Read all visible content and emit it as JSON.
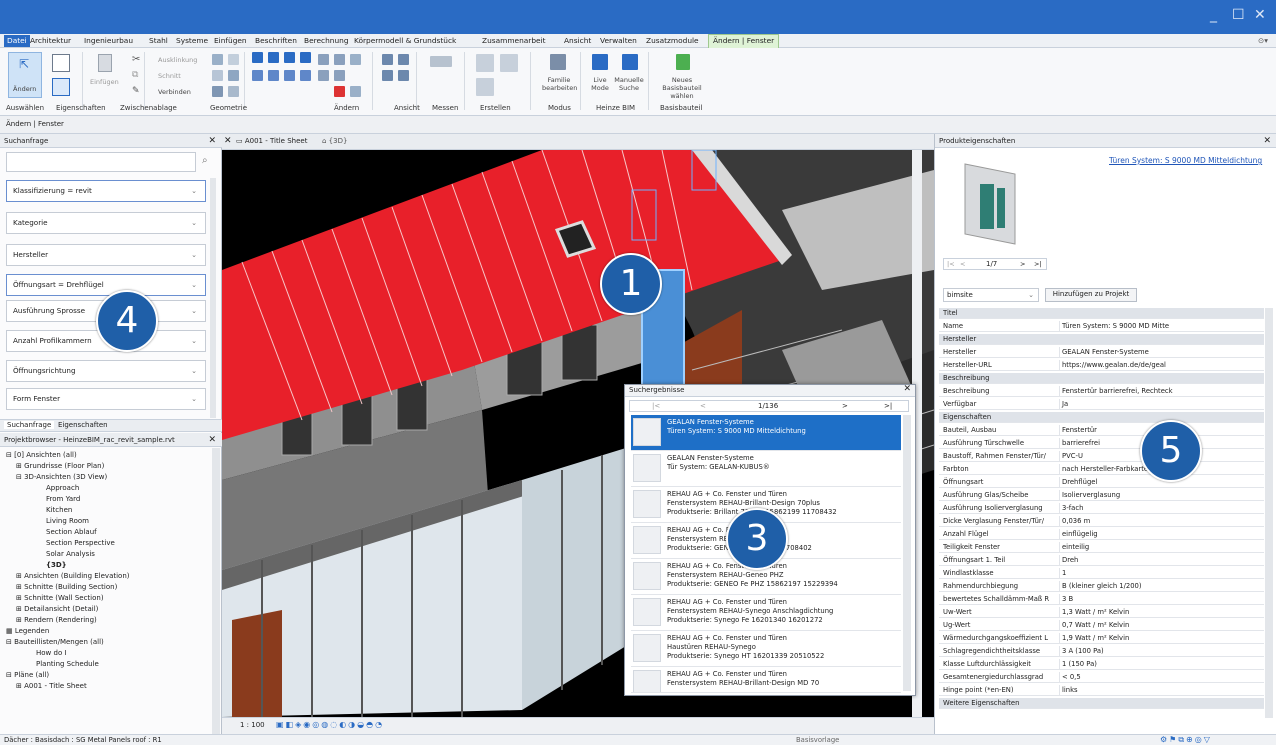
{
  "window": {
    "minimize": "_",
    "maximize": "☐",
    "close": "✕"
  },
  "ribbon_tabs": [
    "Datei",
    "Architektur",
    "Ingenieurbau",
    "Stahl",
    "Systeme",
    "Einfügen",
    "Beschriften",
    "Berechnung",
    "Körpermodell & Grundstück",
    "Zusammenarbeit",
    "Ansicht",
    "Verwalten",
    "Zusatzmodule",
    "Ändern | Fenster"
  ],
  "ribbon": {
    "modify": "Ändern",
    "paste": "Einfügen",
    "tools": {
      "ausklinkung": "Ausklinkung",
      "schnitt": "Schnitt",
      "verbinden": "Verbinden"
    },
    "family_edit": "Familie bearbeiten",
    "live_mode": "Live Mode",
    "manual_search": "Manuelle Suche",
    "new_base": "Neues Basisbauteil wählen",
    "groups": [
      "Auswählen",
      "Eigenschaften",
      "Zwischenablage",
      "Geometrie",
      "Ändern",
      "Ansicht",
      "Messen",
      "Erstellen",
      "Modus",
      "Heinze BIM",
      "Basisbauteil"
    ]
  },
  "context_bar": "Ändern | Fenster",
  "left_panel": {
    "title": "Suchanfrage",
    "search_placeholder": "",
    "filters": [
      "Klassifizierung = revit",
      "Kategorie",
      "Hersteller",
      "Öffnungsart = Drehflügel",
      "Ausführung Sprosse",
      "Anzahl Profilkammern",
      "Öffnungsrichtung",
      "Form Fenster"
    ],
    "tabs": [
      "Suchanfrage",
      "Eigenschaften"
    ],
    "browser_title": "Projektbrowser - HeinzeBIM_rac_revit_sample.rvt",
    "tree": [
      "[0] Ansichten (all)",
      "Grundrisse (Floor Plan)",
      "3D-Ansichten (3D View)",
      "Approach",
      "From Yard",
      "Kitchen",
      "Living Room",
      "Section Ablauf",
      "Section Perspective",
      "Solar Analysis",
      "{3D}",
      "Ansichten (Building Elevation)",
      "Schnitte (Building Section)",
      "Schnitte (Wall Section)",
      "Detailansicht (Detail)",
      "Rendern (Rendering)",
      "Legenden",
      "Bauteillisten/Mengen (all)",
      "How do I",
      "Planting Schedule",
      "Pläne (all)",
      "A001 - Title Sheet"
    ]
  },
  "view_tabs": [
    "A001 - Title Sheet",
    "{3D}"
  ],
  "view_bottom": {
    "scale": "1 : 100"
  },
  "results": {
    "title": "Suchergebnisse",
    "pager": "1/136",
    "items": [
      [
        "GEALAN Fenster-Systeme",
        "Türen System: S 9000 MD Mitteldichtung",
        ""
      ],
      [
        "GEALAN Fenster-Systeme",
        "Tür System: GEALAN-KUBUS®",
        ""
      ],
      [
        "REHAU AG + Co. Fenster und Türen",
        "Fenstersystem REHAU-Brillant-Design 70plus",
        "Produktserie: Brillant 70plus 15862199 11708432"
      ],
      [
        "REHAU AG + Co. Fenster und Türen",
        "Fenstersystem REHAU-Geneo",
        "Produktserie: GENEO 15862199 11708402"
      ],
      [
        "REHAU AG + Co. Fenster und Türen",
        "Fenstersystem REHAU-Geneo PHZ",
        "Produktserie: GENEO Fe PHZ 15862197 15229394"
      ],
      [
        "REHAU AG + Co. Fenster und Türen",
        "Fenstersystem REHAU-Synego Anschlagdichtung",
        "Produktserie: Synego Fe 16201340 16201272"
      ],
      [
        "REHAU AG + Co. Fenster und Türen",
        "Haustüren REHAU-Synego",
        "Produktserie: Synego HT 16201339 20510522"
      ],
      [
        "REHAU AG + Co. Fenster und Türen",
        "Fenstersystem REHAU-Brillant-Design MD 70",
        ""
      ]
    ]
  },
  "right_panel": {
    "title": "Produkteigenschaften",
    "product_link": "Türen System: S 9000 MD Mitteldichtung",
    "pager": "1/7",
    "source": "bimsite",
    "add_button": "Hinzufügen zu Projekt",
    "rows": [
      {
        "h": "Titel"
      },
      {
        "k": "Name",
        "v": "Türen System: S 9000 MD Mitte"
      },
      {
        "h": "Hersteller"
      },
      {
        "k": "Hersteller",
        "v": "GEALAN Fenster-Systeme"
      },
      {
        "k": "Hersteller-URL",
        "v": "https://www.gealan.de/de/geal"
      },
      {
        "h": "Beschreibung"
      },
      {
        "k": "Beschreibung",
        "v": "Fenstertür barrierefrei, Rechteck"
      },
      {
        "k": "Verfügbar",
        "v": "Ja"
      },
      {
        "h": "Eigenschaften"
      },
      {
        "k": "Bauteil, Ausbau",
        "v": "Fenstertür"
      },
      {
        "k": "Ausführung Türschwelle",
        "v": "barrierefrei"
      },
      {
        "k": "Baustoff, Rahmen Fenster/Tür/",
        "v": "PVC-U"
      },
      {
        "k": "Farbton",
        "v": "nach Hersteller-Farbkarte"
      },
      {
        "k": "Öffnungsart",
        "v": "Drehflügel"
      },
      {
        "k": "Ausführung Glas/Scheibe",
        "v": "Isolierverglasung"
      },
      {
        "k": "Ausführung Isolierverglasung",
        "v": "3-fach"
      },
      {
        "k": "Dicke Verglasung Fenster/Tür/",
        "v": "0,036 m"
      },
      {
        "k": "Anzahl Flügel",
        "v": "einflügelig"
      },
      {
        "k": "Teiligkeit Fenster",
        "v": "einteilig"
      },
      {
        "k": "Öffnungsart 1. Teil",
        "v": "Dreh"
      },
      {
        "k": "Windlastklasse",
        "v": "1"
      },
      {
        "k": "Rahmendurchbiegung",
        "v": "B (kleiner gleich 1/200)"
      },
      {
        "k": "bewertetes Schalldämm-Maß R",
        "v": "3 B"
      },
      {
        "k": "Uw-Wert",
        "v": "1,3 Watt / m² Kelvin"
      },
      {
        "k": "Ug-Wert",
        "v": "0,7 Watt / m² Kelvin"
      },
      {
        "k": "Wärmedurchgangskoeffizient L",
        "v": "1,9 Watt / m² Kelvin"
      },
      {
        "k": "Schlagregendichtheitsklasse",
        "v": "3 A (100 Pa)"
      },
      {
        "k": "Klasse Luftdurchlässigkeit",
        "v": "1 (150 Pa)"
      },
      {
        "k": "Gesamtenergiedurchlassgrad",
        "v": "< 0,5"
      },
      {
        "k": "Hinge point (*en-EN)",
        "v": "links"
      },
      {
        "h": "Weitere Eigenschaften"
      }
    ]
  },
  "status": {
    "text": "Dächer : Basisdach : SG Metal Panels roof : R1",
    "template": "Basisvorlage"
  },
  "callouts": [
    "1",
    "3",
    "4",
    "5"
  ],
  "colors": {
    "titlebar": "#2a6bc4",
    "roof": "#e8202a",
    "callout": "#1f5fa8",
    "selection": "#1e6fc7"
  }
}
